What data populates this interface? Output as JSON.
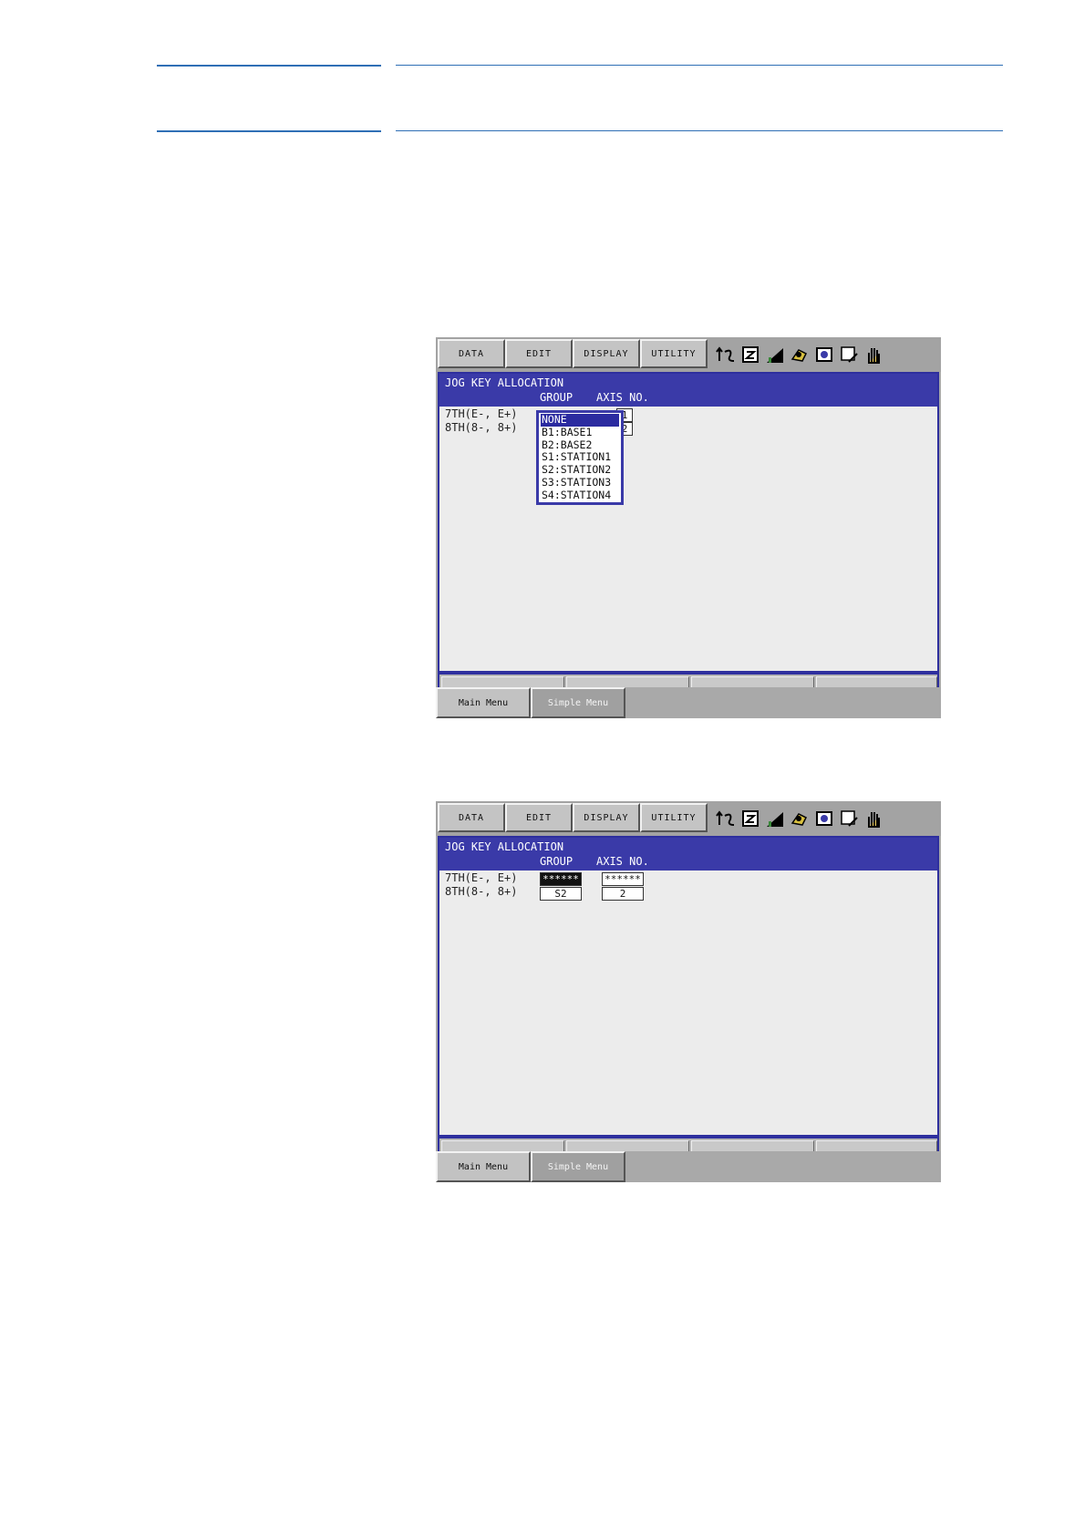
{
  "screen1": {
    "menu": [
      "DATA",
      "EDIT",
      "DISPLAY",
      "UTILITY"
    ],
    "icons": [
      "coordinate-icon",
      "job-icon",
      "speed-icon",
      "robot-icon",
      "camera-icon",
      "edit-icon",
      "hand-icon"
    ],
    "title": "JOG KEY ALLOCATION",
    "col_group": "GROUP",
    "col_axis": "AXIS NO.",
    "rows": [
      {
        "label": "7TH(E-, E+)",
        "axis": "1"
      },
      {
        "label": "8TH(8-, 8+)",
        "axis": "2"
      }
    ],
    "dropdown": [
      "NONE",
      "B1:BASE1",
      "B2:BASE2",
      "S1:STATION1",
      "S2:STATION2",
      "S3:STATION3",
      "S4:STATION4"
    ],
    "dropdown_selected": "NONE",
    "bottom": [
      "Main Menu",
      "Simple Menu"
    ]
  },
  "screen2": {
    "menu": [
      "DATA",
      "EDIT",
      "DISPLAY",
      "UTILITY"
    ],
    "icons": [
      "coordinate-icon",
      "job-icon",
      "speed-icon",
      "robot-icon",
      "camera-icon",
      "edit-icon",
      "hand-icon"
    ],
    "title": "JOG KEY ALLOCATION",
    "col_group": "GROUP",
    "col_axis": "AXIS NO.",
    "rows": [
      {
        "label": "7TH(E-, E+)",
        "group": "******",
        "axis": "******"
      },
      {
        "label": "8TH(8-, 8+)",
        "group": "S2",
        "axis": "2"
      }
    ],
    "bottom": [
      "Main Menu",
      "Simple Menu"
    ]
  }
}
